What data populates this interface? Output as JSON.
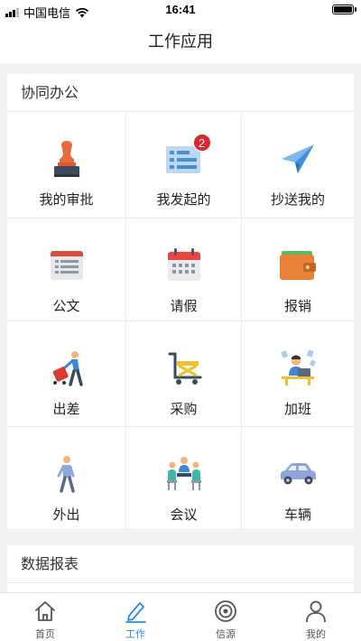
{
  "status_bar": {
    "carrier": "中国电信",
    "time": "16:41"
  },
  "nav": {
    "title": "工作应用"
  },
  "sections": [
    {
      "title": "协同办公",
      "items": [
        {
          "label": "我的审批",
          "icon": "stamp-icon"
        },
        {
          "label": "我发起的",
          "icon": "list-card-icon",
          "badge": "2"
        },
        {
          "label": "抄送我的",
          "icon": "paper-plane-icon"
        },
        {
          "label": "公文",
          "icon": "document-icon"
        },
        {
          "label": "请假",
          "icon": "calendar-icon"
        },
        {
          "label": "报销",
          "icon": "wallet-icon"
        },
        {
          "label": "出差",
          "icon": "traveler-icon"
        },
        {
          "label": "采购",
          "icon": "cart-icon"
        },
        {
          "label": "加班",
          "icon": "worker-desk-icon"
        },
        {
          "label": "外出",
          "icon": "walking-person-icon"
        },
        {
          "label": "会议",
          "icon": "meeting-icon"
        },
        {
          "label": "车辆",
          "icon": "car-icon"
        }
      ]
    },
    {
      "title": "数据报表"
    }
  ],
  "tab_bar": {
    "active": "工作",
    "items": [
      {
        "label": "首页",
        "icon": "home-icon"
      },
      {
        "label": "工作",
        "icon": "pen-icon"
      },
      {
        "label": "信源",
        "icon": "signal-source-icon"
      },
      {
        "label": "我的",
        "icon": "person-icon"
      }
    ]
  },
  "colors": {
    "accent": "#2a8be0",
    "badge": "#d9272d",
    "background": "#f2f2f2"
  }
}
